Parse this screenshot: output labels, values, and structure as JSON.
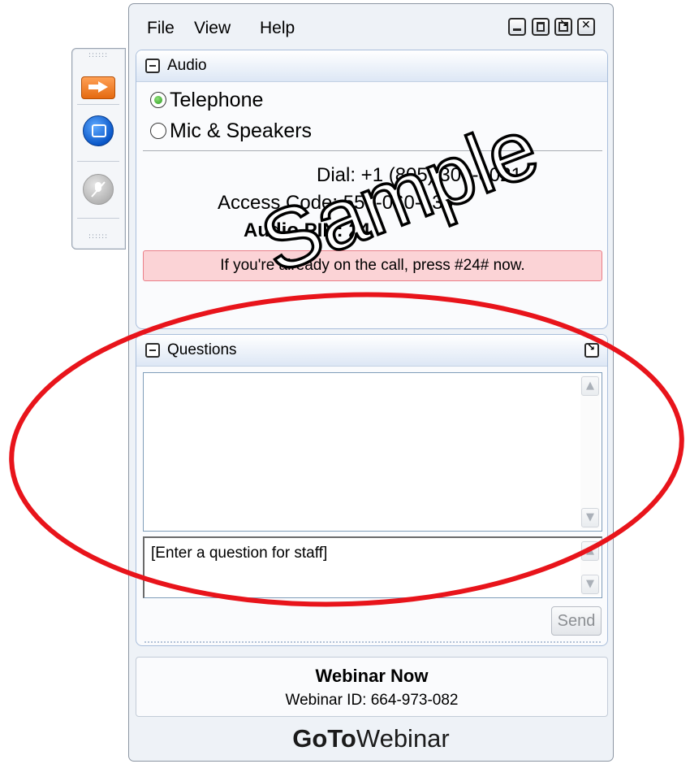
{
  "menu": {
    "file": "File",
    "view": "View",
    "help": "Help"
  },
  "audio": {
    "title": "Audio",
    "options": [
      {
        "label": "Telephone",
        "selected": true
      },
      {
        "label": "Mic & Speakers",
        "selected": false
      }
    ],
    "dial": "Dial: +1 (805) 309-0021",
    "access_code": "Access Code: 558-060-139",
    "audio_pin": "Audio PIN: 24",
    "notice": "If you're already on the call, press #24# now."
  },
  "questions": {
    "title": "Questions",
    "input_placeholder": "[Enter a question for staff]",
    "send": "Send"
  },
  "webinar": {
    "name": "Webinar Now",
    "id": "Webinar ID: 664-973-082"
  },
  "brand": {
    "bold": "GoTo",
    "rest": "Webinar"
  },
  "watermark": "Sample",
  "colors": {
    "notice_bg": "#fbd3d6",
    "annotation": "#e8141b",
    "panel_border": "#a9bedb"
  }
}
